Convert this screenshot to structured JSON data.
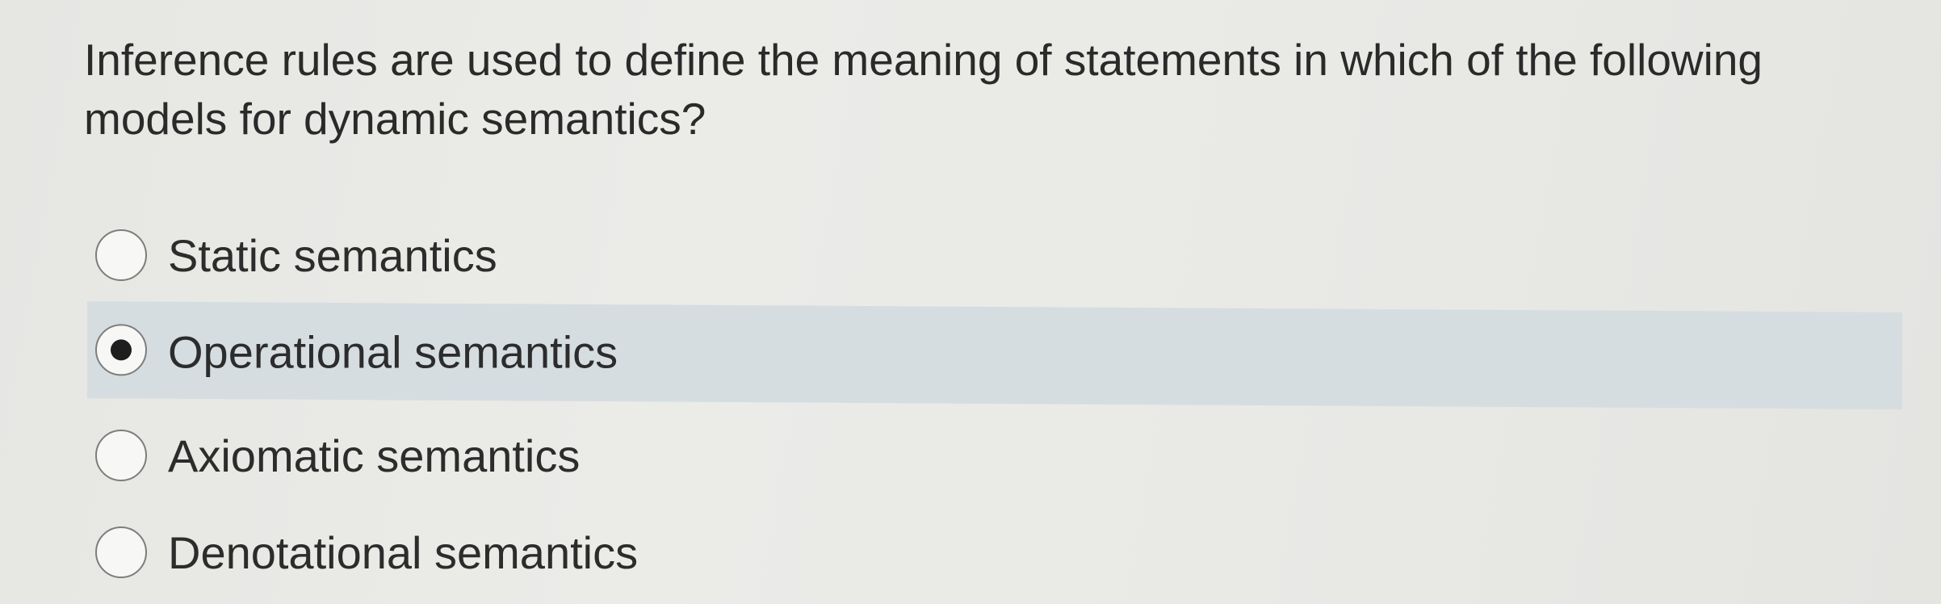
{
  "question": {
    "text": "Inference rules are used to define the meaning of statements in which of the following models for dynamic semantics?"
  },
  "options": [
    {
      "label": "Static semantics",
      "selected": false
    },
    {
      "label": "Operational semantics",
      "selected": true
    },
    {
      "label": "Axiomatic semantics",
      "selected": false
    },
    {
      "label": "Denotational semantics",
      "selected": false
    }
  ],
  "colors": {
    "selected_row_background": "#d5dde1",
    "radio_border": "#7d7d7d",
    "radio_dot": "#1e1e1e",
    "text": "#2c2c2c"
  }
}
